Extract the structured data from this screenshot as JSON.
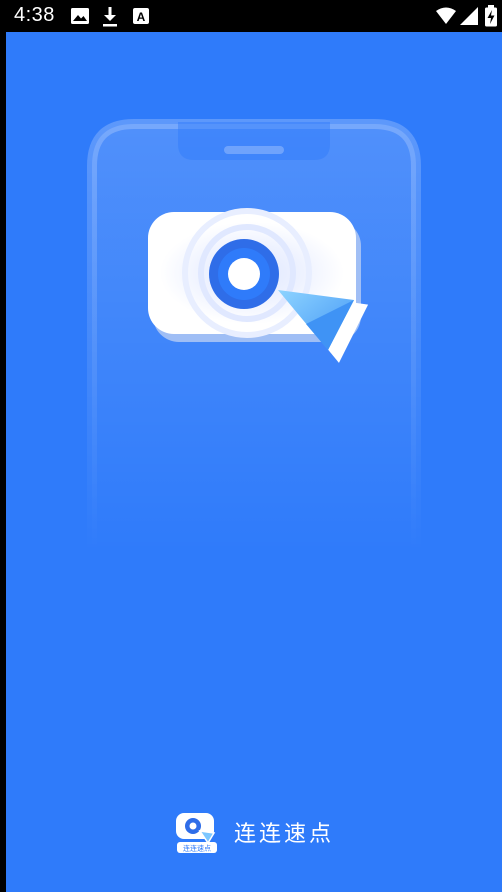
{
  "status_bar": {
    "time": "4:38",
    "left_icons": [
      "image-icon",
      "download-icon",
      "font-a-icon"
    ],
    "right_icons": [
      "wifi-icon",
      "signal-icon",
      "battery-charging-icon"
    ],
    "font_icon_letter": "A"
  },
  "splash": {
    "app_name": "连连速点",
    "logo_caption": "连连速点"
  },
  "colors": {
    "background": "#2f7bfa",
    "accent": "#2f7bfa",
    "card": "#ffffff",
    "cursor_light": "#7cc7ff"
  }
}
